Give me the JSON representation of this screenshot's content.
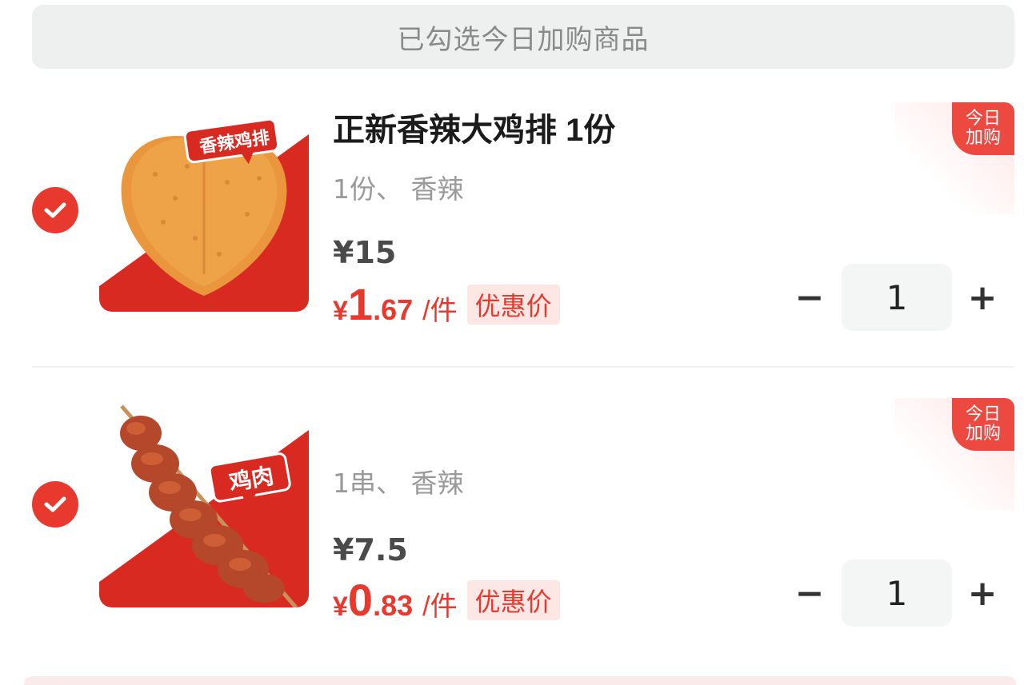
{
  "header": {
    "title": "已勾选今日加购商品"
  },
  "items": [
    {
      "title": "正新香辣大鸡排 1份",
      "spec": "1份、 香辣",
      "original_price": "¥15",
      "price_symbol": "¥",
      "price_int": "1",
      "price_dec": ".67",
      "price_unit": "/件",
      "promo_label": "优惠价",
      "tag_line1": "今日",
      "tag_line2": "加购",
      "image_badge": "香辣鸡排",
      "quantity": "1",
      "minus": "−",
      "plus": "+",
      "checked": true
    },
    {
      "title": "",
      "spec": "1串、 香辣",
      "original_price": "¥7.5",
      "price_symbol": "¥",
      "price_int": "0",
      "price_dec": ".83",
      "price_unit": "/件",
      "promo_label": "优惠价",
      "tag_line1": "今日",
      "tag_line2": "加购",
      "image_badge": "鸡肉",
      "quantity": "1",
      "minus": "−",
      "plus": "+",
      "checked": true
    }
  ],
  "colors": {
    "accent": "#e8392f",
    "header_bg": "#eef0f0",
    "promo_bg": "#fde7e4"
  }
}
